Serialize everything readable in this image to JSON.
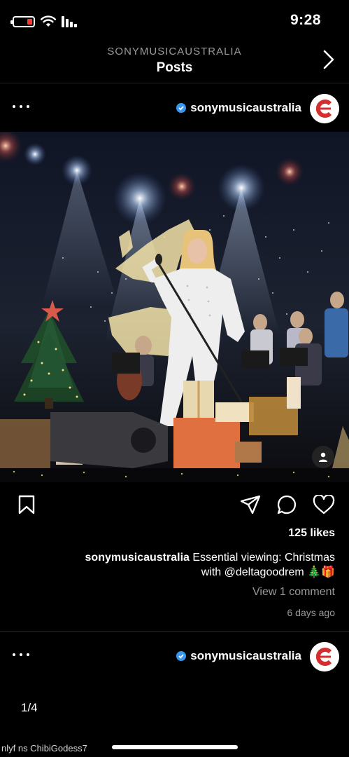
{
  "status_bar": {
    "time": "9:28",
    "battery_level": 0.25,
    "battery_color": "#ff3b30"
  },
  "header": {
    "subtitle": "SONYMUSICAUSTRALIA",
    "title": "Posts",
    "back_icon": "chevron-icon"
  },
  "post": {
    "username": "sonymusicaustralia",
    "verified": true,
    "likes": "125 likes",
    "caption_user": "sonymusicaustralia",
    "caption_line1": "Essential viewing: Christmas",
    "caption_line2": "with @deltagoodrem",
    "caption_emoji": "🎄🎁",
    "view_comments": "View 1 comment",
    "age": "6 days ago",
    "actions": [
      "heart-icon",
      "comment-icon",
      "share-icon",
      "bookmark-icon"
    ]
  },
  "next_post": {
    "username": "sonymusicaustralia",
    "verified": true
  },
  "page_counter": "1/4",
  "footer_text": "nlyf ns ChibiGodess7",
  "colors": {
    "background": "#000000",
    "secondary_text": "#9a9a9a",
    "verified": "#3897f0",
    "brand_red": "#d32f2f"
  }
}
